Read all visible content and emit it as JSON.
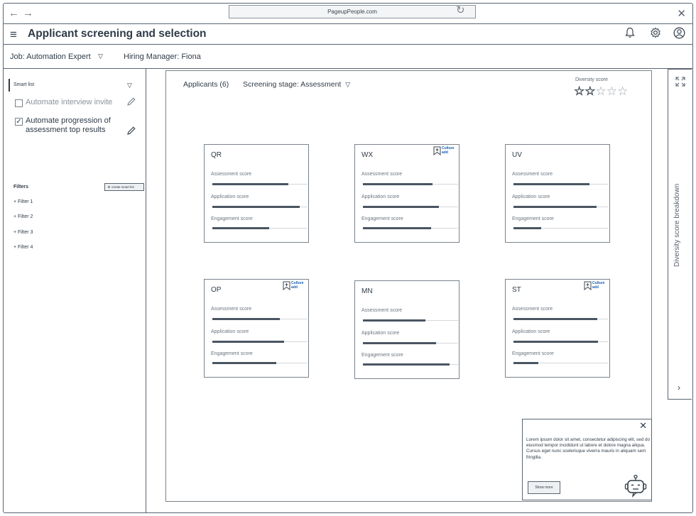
{
  "browser": {
    "back_icon": "←",
    "forward_icon": "→",
    "url": "PageupPeople.com",
    "reload_icon": "↻",
    "close_icon": "✕"
  },
  "header": {
    "menu_icon": "≡",
    "title": "Applicant screening and selection",
    "bell_icon": "🔔",
    "settings_icon": "⚙",
    "user_icon": "☺"
  },
  "job_bar": {
    "job": "Job: Automation Expert",
    "caret": "▽",
    "manager": "Hiring Manager: Fiona"
  },
  "sidebar": {
    "smart_list": "Smart list",
    "caret": "▽",
    "options": [
      {
        "label": "Automate interview invite",
        "checked": false
      },
      {
        "label": "Automate progression of assessment top results",
        "checked": true
      }
    ],
    "filters_title": "Filters",
    "create_button": "create smart list",
    "filters": [
      "+ Filter 1",
      "+ Filter 2",
      "+ Filter 3",
      "+ Filter 4"
    ]
  },
  "main": {
    "applicants": "Applicants (6)",
    "stage": "Screening stage: Assessment",
    "stage_caret": "▽",
    "diversity_label": "Diversity score",
    "diversity_stars": 2,
    "diversity_max": 5,
    "score_labels": [
      "Assessment score",
      "Application score",
      "Engagement score"
    ],
    "culture_label_1": "Culture",
    "culture_label_2": "add",
    "cards": [
      {
        "name": "QR",
        "culture": false,
        "scores": [
          0.8,
          0.92,
          0.6
        ]
      },
      {
        "name": "WX",
        "culture": true,
        "scores": [
          0.73,
          0.8,
          0.72
        ]
      },
      {
        "name": "UV",
        "culture": false,
        "scores": [
          0.8,
          0.87,
          0.29
        ]
      },
      {
        "name": "OP",
        "culture": true,
        "scores": [
          0.71,
          0.75,
          0.67
        ]
      },
      {
        "name": "MN",
        "culture": false,
        "scores": [
          0.66,
          0.77,
          0.91
        ]
      },
      {
        "name": "ST",
        "culture": true,
        "scores": [
          0.88,
          0.89,
          0.26
        ]
      }
    ]
  },
  "right_panel": {
    "label": "Diversity score breakdown",
    "expand_icon": "⤢",
    "chevron": "›"
  },
  "chat": {
    "close": "✕",
    "text": "Lorem ipsum dolor sit amet, consectetur adipiscing elit, sed do eiusmod tempor incididunt ut labore et dolore magna aliqua. Cursus eget nunc scelerisque viverra mauris in aliquam sem fringilla.",
    "button": "Show more"
  }
}
